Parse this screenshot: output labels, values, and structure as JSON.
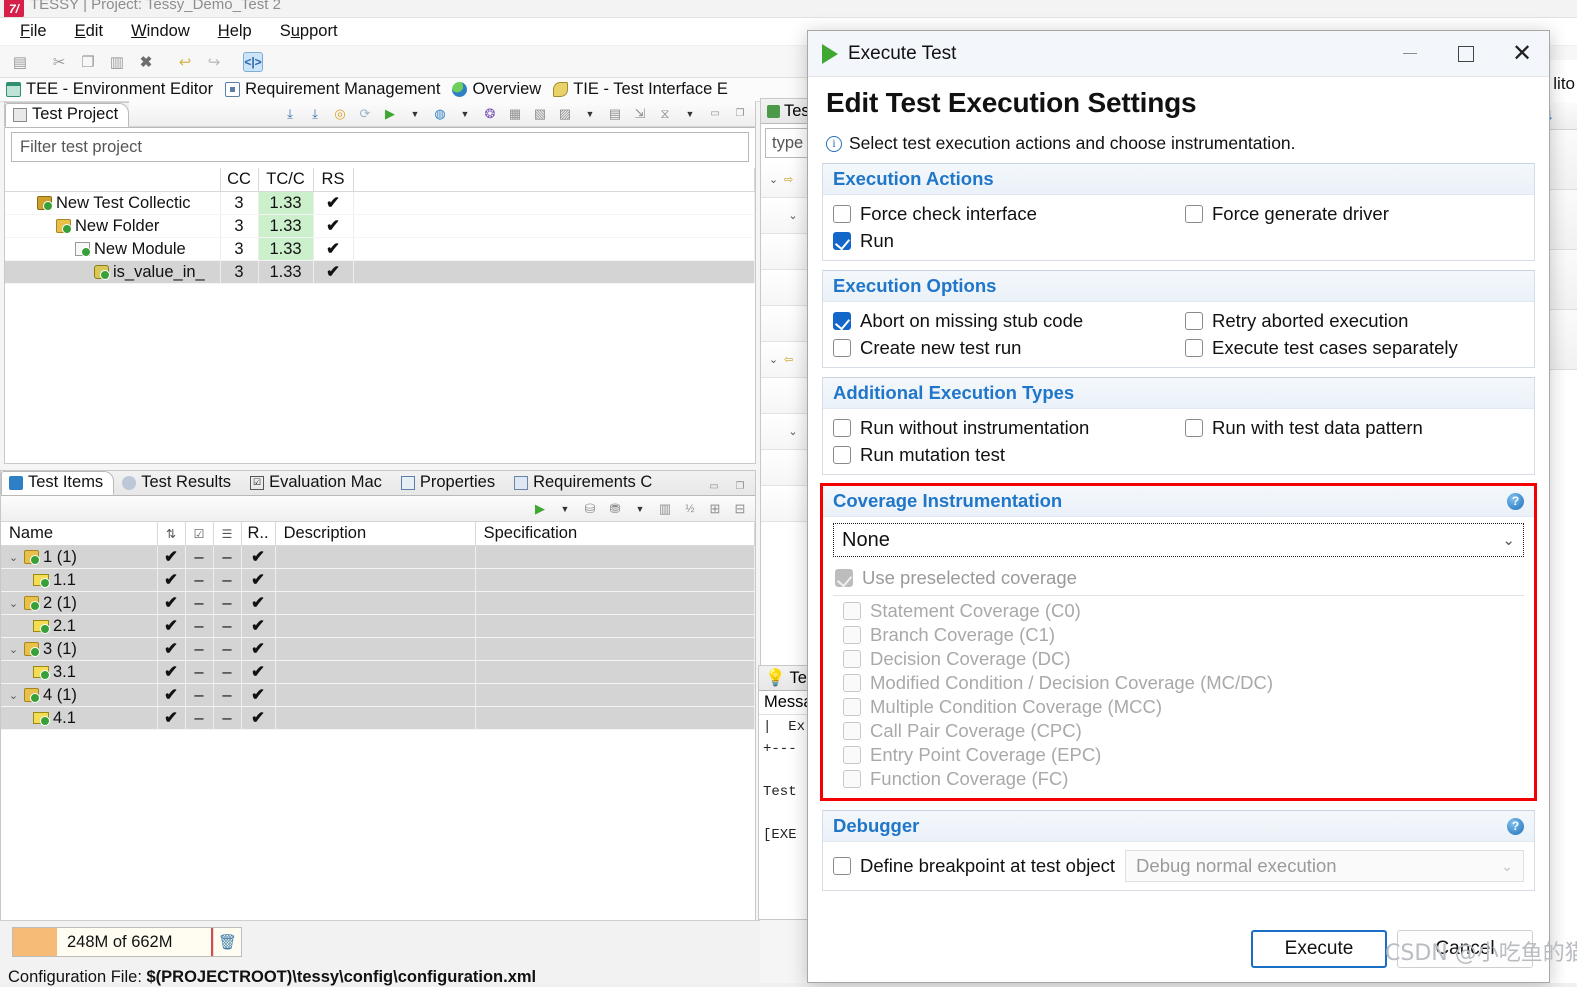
{
  "window": {
    "title": "TESSY | Project: Tessy_Demo_Test 2",
    "logo": "tessy-logo"
  },
  "menubar": [
    {
      "label": "File"
    },
    {
      "label": "Edit"
    },
    {
      "label": "Window"
    },
    {
      "label": "Help"
    },
    {
      "label": "Support"
    }
  ],
  "toolbar": {
    "icons": [
      "save-icon",
      "cut-icon",
      "copy-icon",
      "paste-icon",
      "delete-icon",
      "undo-icon",
      "redo-icon",
      "code-view-icon"
    ],
    "code_glyph": "<|>"
  },
  "perspectives": [
    {
      "label": "TEE - Environment Editor",
      "icon": "grid-icon"
    },
    {
      "label": "Requirement Management",
      "icon": "document-icon"
    },
    {
      "label": "Overview",
      "icon": "globe-icon"
    },
    {
      "label": "TIE - Test Interface E",
      "icon": "interface-icon"
    },
    {
      "label": "lito",
      "icon": "editor-icon"
    }
  ],
  "test_project_view": {
    "tab_label": "Test Project",
    "tab_icon": "project-icon",
    "filter_placeholder": "Filter test project",
    "toolbar_icons": [
      "import-icon",
      "export-icon",
      "analyze-icon",
      "refresh-icon",
      "run-icon",
      "run-dropdown",
      "report-icon",
      "report-dropdown",
      "coverage-icon",
      "add-collection-icon",
      "add-folder-icon",
      "add-module-icon",
      "add-module-dropdown",
      "copy-module-icon",
      "move-icon",
      "filter-icon",
      "filter-dropdown",
      "minimize-icon",
      "maximize-icon"
    ],
    "columns": [
      "",
      "CC",
      "TC/C",
      "RS"
    ],
    "rows": [
      {
        "name": "New Test Collectic",
        "icon": "test-collection-icon",
        "indent": 0,
        "cc": "3",
        "tcc": "1.33",
        "rs": "✔",
        "selected": false
      },
      {
        "name": "New Folder",
        "icon": "folder-icon",
        "indent": 1,
        "cc": "3",
        "tcc": "1.33",
        "rs": "✔",
        "selected": false
      },
      {
        "name": "New Module",
        "icon": "module-icon",
        "indent": 2,
        "cc": "3",
        "tcc": "1.33",
        "rs": "✔",
        "selected": false
      },
      {
        "name": "is_value_in_",
        "icon": "function-icon",
        "indent": 3,
        "cc": "3",
        "tcc": "1.33",
        "rs": "✔",
        "selected": true
      }
    ]
  },
  "test_items_view": {
    "tabs": [
      {
        "label": "Test Items",
        "icon": "test-items-icon",
        "selected": true
      },
      {
        "label": "Test Results",
        "icon": "test-results-icon",
        "selected": false
      },
      {
        "label": "Evaluation Mac",
        "icon": "evaluation-macro-icon",
        "selected": false
      },
      {
        "label": "Properties",
        "icon": "properties-icon",
        "selected": false
      },
      {
        "label": "Requirements C",
        "icon": "requirements-icon",
        "selected": false
      }
    ],
    "toolbar_icons": [
      "run-icon",
      "run-dropdown",
      "add-testcase-icon",
      "add-testsequence-icon",
      "add-dropdown",
      "delete-icon",
      "numbering-icon",
      "expand-all-icon",
      "collapse-all-icon"
    ],
    "columns": [
      "Name",
      "",
      "",
      "",
      "R..",
      "Description",
      "Specification"
    ],
    "rows": [
      {
        "name": "1 (1)",
        "icon": "test-case-icon",
        "indent": 0,
        "expander": "⌄",
        "c1": "✔",
        "c2": "–",
        "c3": "–",
        "c4": "✔",
        "description": "",
        "specification": ""
      },
      {
        "name": "1.1",
        "icon": "test-step-icon",
        "indent": 1,
        "expander": "",
        "c1": "✔",
        "c2": "–",
        "c3": "–",
        "c4": "✔",
        "description": "",
        "specification": ""
      },
      {
        "name": "2 (1)",
        "icon": "test-case-icon",
        "indent": 0,
        "expander": "⌄",
        "c1": "✔",
        "c2": "–",
        "c3": "–",
        "c4": "✔",
        "description": "",
        "specification": ""
      },
      {
        "name": "2.1",
        "icon": "test-step-icon",
        "indent": 1,
        "expander": "",
        "c1": "✔",
        "c2": "–",
        "c3": "–",
        "c4": "✔",
        "description": "",
        "specification": ""
      },
      {
        "name": "3 (1)",
        "icon": "test-case-icon",
        "indent": 0,
        "expander": "⌄",
        "c1": "✔",
        "c2": "–",
        "c3": "–",
        "c4": "✔",
        "description": "",
        "specification": ""
      },
      {
        "name": "3.1",
        "icon": "test-step-icon",
        "indent": 1,
        "expander": "",
        "c1": "✔",
        "c2": "–",
        "c3": "–",
        "c4": "✔",
        "description": "",
        "specification": ""
      },
      {
        "name": "4 (1)",
        "icon": "test-case-icon",
        "indent": 0,
        "expander": "⌄",
        "c1": "✔",
        "c2": "–",
        "c3": "–",
        "c4": "✔",
        "description": "",
        "specification": ""
      },
      {
        "name": "4.1",
        "icon": "test-step-icon",
        "indent": 1,
        "expander": "",
        "c1": "✔",
        "c2": "–",
        "c3": "–",
        "c4": "✔",
        "description": "",
        "specification": ""
      }
    ]
  },
  "middle_panel": {
    "tab_label": "Tes",
    "tab_icon": "test-data-icon",
    "filter_placeholder": "type"
  },
  "log_panel": {
    "tab_label": "Tes",
    "tab_icon": "lightbulb-icon",
    "header": "Messa",
    "lines": "|  Ex\n+---\n\nTest\n\n[EXE"
  },
  "statusbar": {
    "heap": "248M of 662M",
    "trash_icon": "trash-icon",
    "config_label": "Configuration File:",
    "config_value": "$(PROJECTROOT)\\tessy\\config\\configuration.xml"
  },
  "dialog": {
    "window_title": "Execute Test",
    "window_icon": "run-icon",
    "minimize_label": "",
    "maximize_label": "",
    "close_label": "✕",
    "heading": "Edit Test Execution Settings",
    "subtitle": "Select test execution actions and choose instrumentation.",
    "sections": {
      "execution_actions": {
        "title": "Execution Actions",
        "items": [
          {
            "label": "Force check interface",
            "checked": false,
            "disabled": false
          },
          {
            "label": "Force generate driver",
            "checked": false,
            "disabled": false
          },
          {
            "label": "Run",
            "checked": true,
            "disabled": false
          }
        ]
      },
      "execution_options": {
        "title": "Execution Options",
        "items": [
          {
            "label": "Abort on missing stub code",
            "checked": true,
            "disabled": false
          },
          {
            "label": "Retry aborted execution",
            "checked": false,
            "disabled": false
          },
          {
            "label": "Create new test run",
            "checked": false,
            "disabled": false
          },
          {
            "label": "Execute test cases separately",
            "checked": false,
            "disabled": false
          }
        ]
      },
      "additional_execution_types": {
        "title": "Additional Execution Types",
        "items": [
          {
            "label": "Run without instrumentation",
            "checked": false,
            "disabled": false
          },
          {
            "label": "Run with test data pattern",
            "checked": false,
            "disabled": false
          },
          {
            "label": "Run mutation test",
            "checked": false,
            "disabled": false
          }
        ]
      },
      "coverage_instrumentation": {
        "title": "Coverage Instrumentation",
        "help_icon": "help-icon",
        "highlight_color": "#f40000",
        "combo_value": "None",
        "combo_options": [
          "None"
        ],
        "use_preselected": {
          "label": "Use preselected coverage",
          "checked": true,
          "disabled": true
        },
        "items": [
          {
            "label": "Statement Coverage (C0)",
            "checked": false,
            "disabled": true
          },
          {
            "label": "Branch Coverage (C1)",
            "checked": false,
            "disabled": true
          },
          {
            "label": "Decision Coverage (DC)",
            "checked": false,
            "disabled": true
          },
          {
            "label": "Modified Condition / Decision Coverage (MC/DC)",
            "checked": false,
            "disabled": true
          },
          {
            "label": "Multiple Condition Coverage (MCC)",
            "checked": false,
            "disabled": true
          },
          {
            "label": "Call Pair Coverage (CPC)",
            "checked": false,
            "disabled": true
          },
          {
            "label": "Entry Point Coverage (EPC)",
            "checked": false,
            "disabled": true
          },
          {
            "label": "Function Coverage (FC)",
            "checked": false,
            "disabled": true
          }
        ]
      },
      "debugger": {
        "title": "Debugger",
        "help_icon": "help-icon",
        "breakpoint": {
          "label": "Define breakpoint at test object",
          "checked": false,
          "disabled": false
        },
        "combo_value": "Debug normal execution"
      }
    },
    "buttons": {
      "execute": "Execute",
      "cancel": "Cancel"
    }
  },
  "watermark": "CSDN @小吃鱼的猫"
}
